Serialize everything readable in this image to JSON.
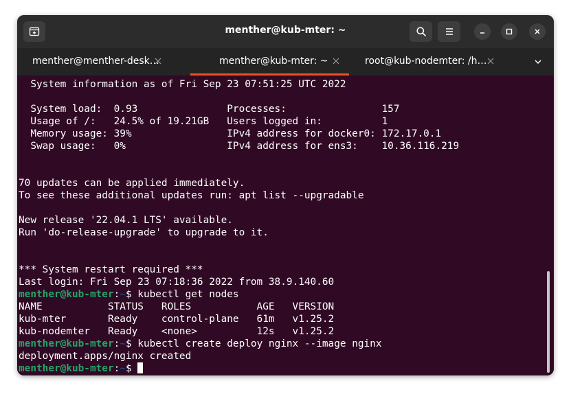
{
  "window": {
    "title": "menther@kub-mter: ~"
  },
  "tabs": [
    {
      "label": "menther@menther-desk…",
      "active": false
    },
    {
      "label": "menther@kub-mter: ~",
      "active": true
    },
    {
      "label": "root@kub-nodemter: /h…",
      "active": false
    }
  ],
  "icons": {
    "new_tab": "new-tab-icon",
    "search": "search-icon",
    "menu": "hamburger-menu-icon",
    "minimize": "minimize-icon",
    "maximize": "maximize-icon",
    "close": "close-icon",
    "tab_close": "close-icon",
    "tabs_overflow": "chevron-down-icon"
  },
  "colors": {
    "terminal_bg": "#300a24",
    "prompt_user": "#26a269",
    "prompt_path": "#12488b",
    "tab_accent": "#e95420"
  },
  "terminal": {
    "sysinfo_header": "  System information as of Fri Sep 23 07:51:25 UTC 2022",
    "sysinfo_rows": [
      "  System load:  0.93               Processes:                157",
      "  Usage of /:   24.5% of 19.21GB   Users logged in:          1",
      "  Memory usage: 39%                IPv4 address for docker0: 172.17.0.1",
      "  Swap usage:   0%                 IPv4 address for ens3:    10.36.116.219"
    ],
    "updates_line1": "70 updates can be applied immediately.",
    "updates_line2": "To see these additional updates run: apt list --upgradable",
    "release_line1": "New release '22.04.1 LTS' available.",
    "release_line2": "Run 'do-release-upgrade' to upgrade to it.",
    "restart_line": "*** System restart required ***",
    "last_login": "Last login: Fri Sep 23 07:18:36 2022 from 38.9.140.60",
    "prompt_user": "menther@kub-mter",
    "prompt_sep": ":",
    "prompt_path": "~",
    "prompt_symbol": "$ ",
    "cmd1": "kubectl get nodes",
    "nodes_header": "NAME           STATUS   ROLES           AGE   VERSION",
    "nodes_rows": [
      "kub-mter       Ready    control-plane   61m   v1.25.2",
      "kub-nodemter   Ready    <none>          12s   v1.25.2"
    ],
    "cmd2": "kubectl create deploy nginx --image nginx",
    "cmd2_output": "deployment.apps/nginx created",
    "cmd3": ""
  }
}
